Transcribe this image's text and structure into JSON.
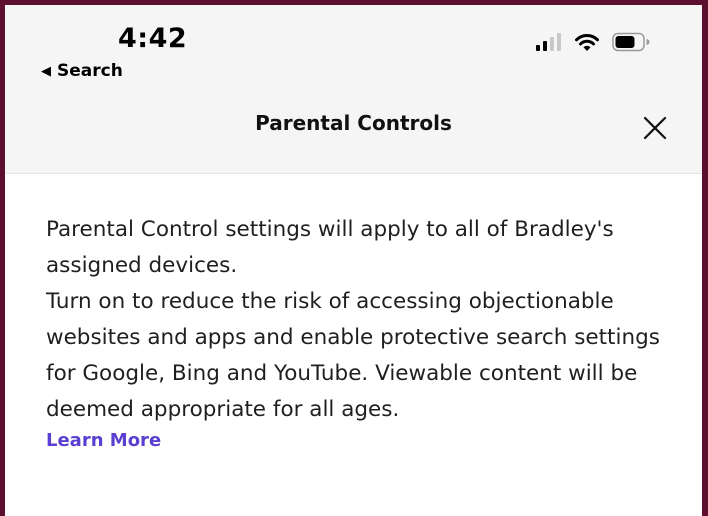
{
  "status_bar": {
    "time": "4:42",
    "back_label": "Search",
    "icons": [
      "cellular-signal-icon",
      "wifi-icon",
      "battery-icon"
    ]
  },
  "header": {
    "title": "Parental Controls",
    "close_icon": "close-icon"
  },
  "content": {
    "paragraph_1": "Parental Control settings will apply to all of Bradley's assigned devices.",
    "paragraph_2": "Turn on to reduce the risk of accessing objectionable websites and apps and enable protective search settings for Google, Bing and YouTube. Viewable content will be deemed appropriate for all ages.",
    "learn_more_label": "Learn More"
  },
  "colors": {
    "frame_border": "#5e0f30",
    "header_background": "#f5f5f6",
    "link": "#5b3fd1",
    "body_text": "#1f1f1f"
  }
}
